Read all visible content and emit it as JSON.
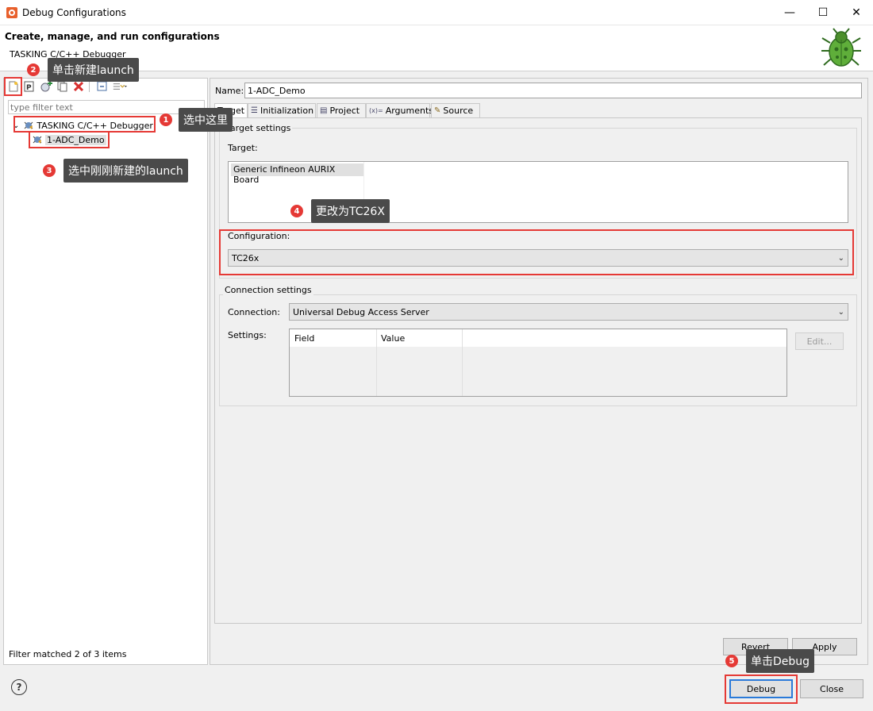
{
  "window": {
    "title": "Debug Configurations",
    "minimize_glyph": "—",
    "maximize_glyph": "☐",
    "close_glyph": "✕"
  },
  "header": {
    "title": "Create, manage, and run configurations",
    "subtitle": "TASKING C/C++ Debugger"
  },
  "left": {
    "toolbar": {
      "icons": [
        "new-configuration-icon",
        "new-prototype-icon",
        "export-icon",
        "duplicate-icon",
        "delete-icon",
        "collapse-all-icon",
        "filter-icon"
      ]
    },
    "filter_placeholder": "type filter text",
    "tree": {
      "root": {
        "expander": "⌄",
        "label": "TASKING C/C++ Debugger"
      },
      "child": {
        "label": "1-ADC_Demo"
      }
    },
    "status": "Filter matched 2 of 3 items"
  },
  "right": {
    "name_label": "Name:",
    "name_value": "1-ADC_Demo",
    "tabs": [
      {
        "label": "Target",
        "icon": ""
      },
      {
        "label": "Initialization",
        "icon": "☰"
      },
      {
        "label": "Project",
        "icon": "▤"
      },
      {
        "label": "Arguments",
        "icon": "(x)="
      },
      {
        "label": "Source",
        "icon": "✎"
      }
    ],
    "target_settings": {
      "title": "Target settings",
      "target_label": "Target:",
      "target_item": "Generic Infineon AURIX Board",
      "configuration_label": "Configuration:",
      "configuration_value": "TC26x"
    },
    "connection_settings": {
      "title": "Connection settings",
      "connection_label": "Connection:",
      "connection_value": "Universal Debug Access Server",
      "settings_label": "Settings:",
      "columns": [
        "Field",
        "Value"
      ],
      "edit_button": "Edit..."
    },
    "revert_button": "Revert",
    "apply_button": "Apply"
  },
  "footer": {
    "help_glyph": "?",
    "debug_button": "Debug",
    "close_button": "Close"
  },
  "annotations": [
    {
      "num": "1",
      "text": "选中这里"
    },
    {
      "num": "2",
      "text": "单击新建launch"
    },
    {
      "num": "3",
      "text": "选中刚刚新建的launch"
    },
    {
      "num": "4",
      "text": "更改为TC26X"
    },
    {
      "num": "5",
      "text": "单击Debug"
    }
  ],
  "colors": {
    "annotation_red": "#e53935",
    "callout_bg": "#4a4a4a",
    "focus_blue": "#2a7ad9"
  }
}
